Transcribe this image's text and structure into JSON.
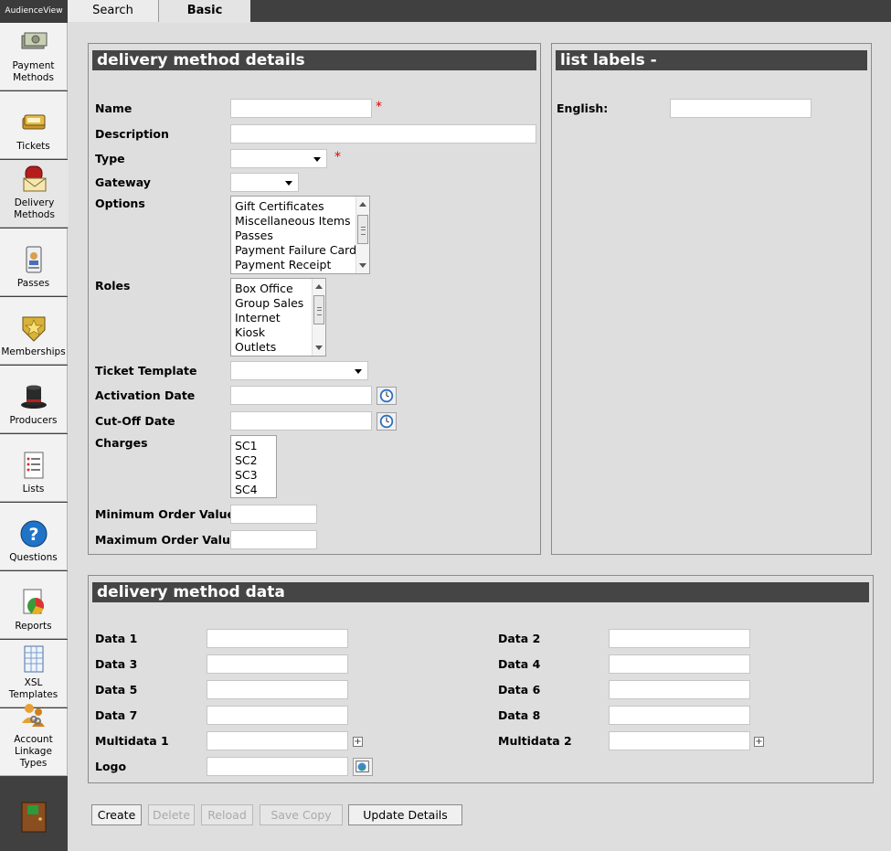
{
  "app": {
    "brand": "AudienceView"
  },
  "tabs": [
    {
      "label": "Search"
    },
    {
      "label": "Basic"
    }
  ],
  "sidebar": {
    "items": [
      {
        "label": "Payment Methods",
        "icon": "money-icon"
      },
      {
        "label": "Tickets",
        "icon": "ticket-icon"
      },
      {
        "label": "Delivery Methods",
        "icon": "mailbox-icon"
      },
      {
        "label": "Passes",
        "icon": "pass-card-icon"
      },
      {
        "label": "Memberships",
        "icon": "badge-icon"
      },
      {
        "label": "Producers",
        "icon": "top-hat-icon"
      },
      {
        "label": "Lists",
        "icon": "list-icon"
      },
      {
        "label": "Questions",
        "icon": "question-icon"
      },
      {
        "label": "Reports",
        "icon": "report-icon"
      },
      {
        "label": "XSL Templates",
        "icon": "template-icon"
      },
      {
        "label": "Account Linkage Types",
        "icon": "account-linkage-icon"
      }
    ],
    "logout_icon": "exit-door-icon"
  },
  "details": {
    "title": "delivery method details",
    "required_mark": "*",
    "labels": {
      "name": "Name",
      "description": "Description",
      "type": "Type",
      "gateway": "Gateway",
      "options": "Options",
      "roles": "Roles",
      "ticket_template": "Ticket Template",
      "activation_date": "Activation Date",
      "cutoff_date": "Cut-Off Date",
      "charges": "Charges",
      "min_order": "Minimum Order Value",
      "max_order": "Maximum Order Value"
    },
    "options": [
      "Gift Certificates",
      "Miscellaneous Items",
      "Passes",
      "Payment Failure Card",
      "Payment Receipt"
    ],
    "roles": [
      "Box Office",
      "Group Sales",
      "Internet",
      "Kiosk",
      "Outlets"
    ],
    "charges": [
      "SC1",
      "SC2",
      "SC3",
      "SC4"
    ]
  },
  "list_labels": {
    "title": "list labels -",
    "english_label": "English:"
  },
  "data_panel": {
    "title": "delivery method data",
    "labels": {
      "data1": "Data 1",
      "data2": "Data 2",
      "data3": "Data 3",
      "data4": "Data 4",
      "data5": "Data 5",
      "data6": "Data 6",
      "data7": "Data 7",
      "data8": "Data 8",
      "multidata1": "Multidata 1",
      "multidata2": "Multidata 2",
      "logo": "Logo"
    }
  },
  "buttons": {
    "create": "Create",
    "delete": "Delete",
    "reload": "Reload",
    "save_copy": "Save Copy",
    "update": "Update Details"
  }
}
